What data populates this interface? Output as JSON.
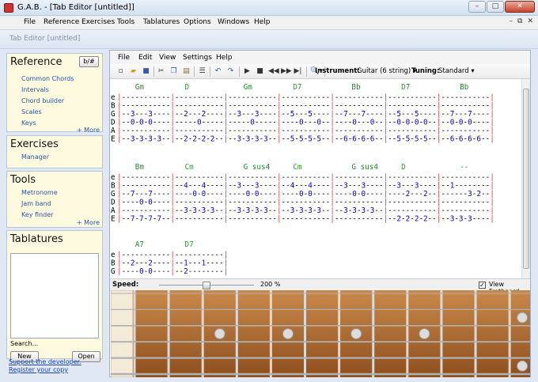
{
  "window": {
    "title": "G.A.B. - [Tab Editor [untitled]]",
    "controls": [
      "–",
      "□",
      "✕"
    ]
  },
  "menubar": [
    "File",
    "Reference",
    "Exercises",
    "Tools",
    "Tablatures",
    "Options",
    "Windows",
    "Help"
  ],
  "mdi_controls": [
    "–",
    "⧉",
    "✕"
  ],
  "document_tab": "Tab Editor [untitled]",
  "sidebar": {
    "reference": {
      "title": "Reference",
      "button": "b/#",
      "links": [
        "Common Chords",
        "Intervals",
        "Chord builder",
        "Scales",
        "Keys"
      ],
      "more": "+ More"
    },
    "exercises": {
      "title": "Exercises",
      "links": [
        "Manager"
      ]
    },
    "tools": {
      "title": "Tools",
      "links": [
        "Metronome",
        "Jam band",
        "Key finder"
      ],
      "more": "+ More"
    },
    "tablatures": {
      "title": "Tablatures",
      "search_label": "Search...",
      "search_value": "",
      "new_button": "New",
      "open_button": "Open"
    },
    "support_link": "Support the developer. Register your copy"
  },
  "editor": {
    "menu": [
      "File",
      "Edit",
      "View",
      "Settings",
      "Help"
    ],
    "toolbar_icons": [
      "new-file-icon",
      "open-folder-icon",
      "save-icon",
      "cut-icon",
      "copy-icon",
      "paste-icon",
      "list-icon",
      "undo-icon",
      "redo-icon",
      "play-icon",
      "stop-icon",
      "rewind-icon",
      "fast-forward-icon",
      "skip-end-icon",
      "zoom-icon"
    ],
    "instrument_label": "Instrument:",
    "instrument_value": "Guitar (6 string)",
    "tuning_label": "Tuning:",
    "tuning_value": "Standard",
    "speed_label": "Speed:",
    "speed_value": "200 %",
    "speed_fraction": 0.5,
    "view_fretboard_label": "View Fretboard",
    "view_fretboard_checked": true
  },
  "tab": {
    "string_names": [
      "e",
      "B",
      "G",
      "D",
      "A",
      "E"
    ],
    "colors": {
      "chord_minor": "#1f8a2d",
      "chord_major": "#2e9a2e",
      "bar_line": "#d04040",
      "string_name": "#d04040",
      "text": "#0000cc"
    },
    "systems": [
      {
        "chords": [
          "Gm",
          "D",
          "Gm",
          "D7",
          "Bb",
          "D7",
          "Bb"
        ],
        "lines": [
          "|-----------|-----------|-----------|-----------|-----------|-----------|-----------|",
          "|-----------|-----------|-----------|-----------|-----------|-----------|-----------|",
          "|--3---3----|--2---2----|--3---3----|--5---5----|--7---7----|--5---5----|--7---7----|",
          "|--0-0-0----|-----0-----|-----0-----|----0---0--|----0---0--|--0-0-0-0--|--0-0-0----|",
          "|-----------|-----------|-----------|-----------|-----------|-----------|-----------|",
          "|--3-3-3-3--|--2-2-2-2--|--3-3-3-3--|--5-5-5-5--|--6-6-6-6--|--5-5-5-5--|--6-6-6-6--|"
        ]
      },
      {
        "chords": [
          "Bm",
          "Cm",
          "G sus4",
          "Cm",
          "G sus4",
          "D",
          "--"
        ],
        "lines": [
          "|-----------|-----------|-----------|-----------|-----------|-----------|-----------|",
          "|-----------|--4---4----|--3---3----|--4---4----|--3---3----|--3---3----|--1--------|",
          "|--7---7----|----0-0----|----0-0----|----0-0----|----0-0----|----2---2--|------3-2--|",
          "|----0-0----|-----------|-----------|-----------|-----------|-----------|-----------|",
          "|-----------|--3-3-3-3--|--3-3-3-3--|--3-3-3-3--|--3-3-3-3--|-----------|-----------|",
          "|--7-7-7-7--|-----------|-----------|-----------|-----------|--2-2-2-2--|--3-3-3----|"
        ]
      },
      {
        "chords": [
          "A7",
          "D7"
        ],
        "lines": [
          "|-----------|-----------|",
          "|--2---2----|--1---1----|",
          "|----0-0----|--2--------|"
        ]
      }
    ]
  },
  "fretboard": {
    "fret_count": 11,
    "markers": [
      {
        "fret": 3,
        "string": 2
      },
      {
        "fret": 5,
        "string": 2
      },
      {
        "fret": 7,
        "string": 2
      },
      {
        "fret": 9,
        "string": 2
      },
      {
        "fret": 12,
        "string": 1
      },
      {
        "fret": 12,
        "string": 4
      }
    ],
    "colors": {
      "wood_light": "#c9894a",
      "wood_dark": "#8f4f1e",
      "fret": "#d9d9d9",
      "nut": "#f3ead8"
    }
  }
}
